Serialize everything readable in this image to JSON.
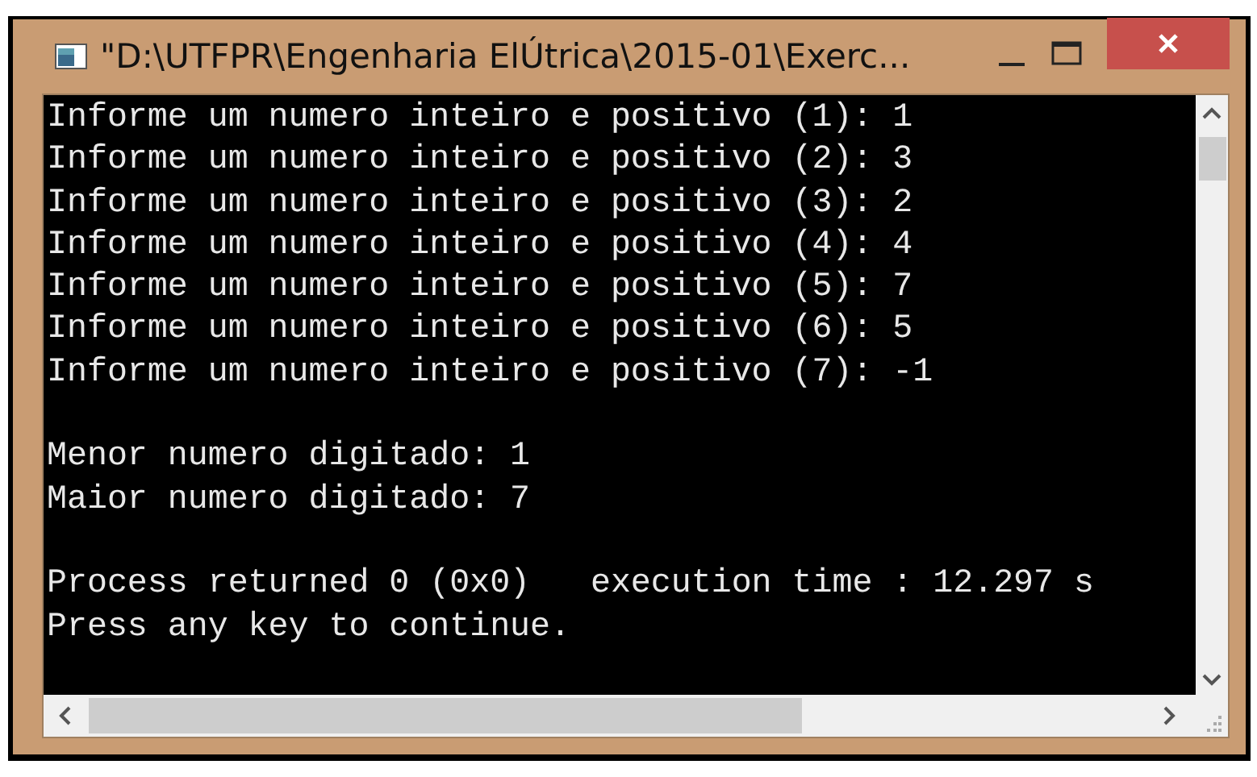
{
  "window": {
    "title": "\"D:\\UTFPR\\Engenharia ElÚtrica\\2015-01\\Exerc..."
  },
  "console": {
    "blocks": [
      [
        "Informe um numero inteiro e positivo (1): 1",
        "Informe um numero inteiro e positivo (2): 3",
        "Informe um numero inteiro e positivo (3): 2",
        "Informe um numero inteiro e positivo (4): 4",
        "Informe um numero inteiro e positivo (5): 7",
        "Informe um numero inteiro e positivo (6): 5",
        "Informe um numero inteiro e positivo (7): -1"
      ],
      [
        "Menor numero digitado: 1",
        "Maior numero digitado: 7"
      ],
      [
        "Process returned 0 (0x0)   execution time : 12.297 s",
        "Press any key to continue."
      ]
    ]
  }
}
